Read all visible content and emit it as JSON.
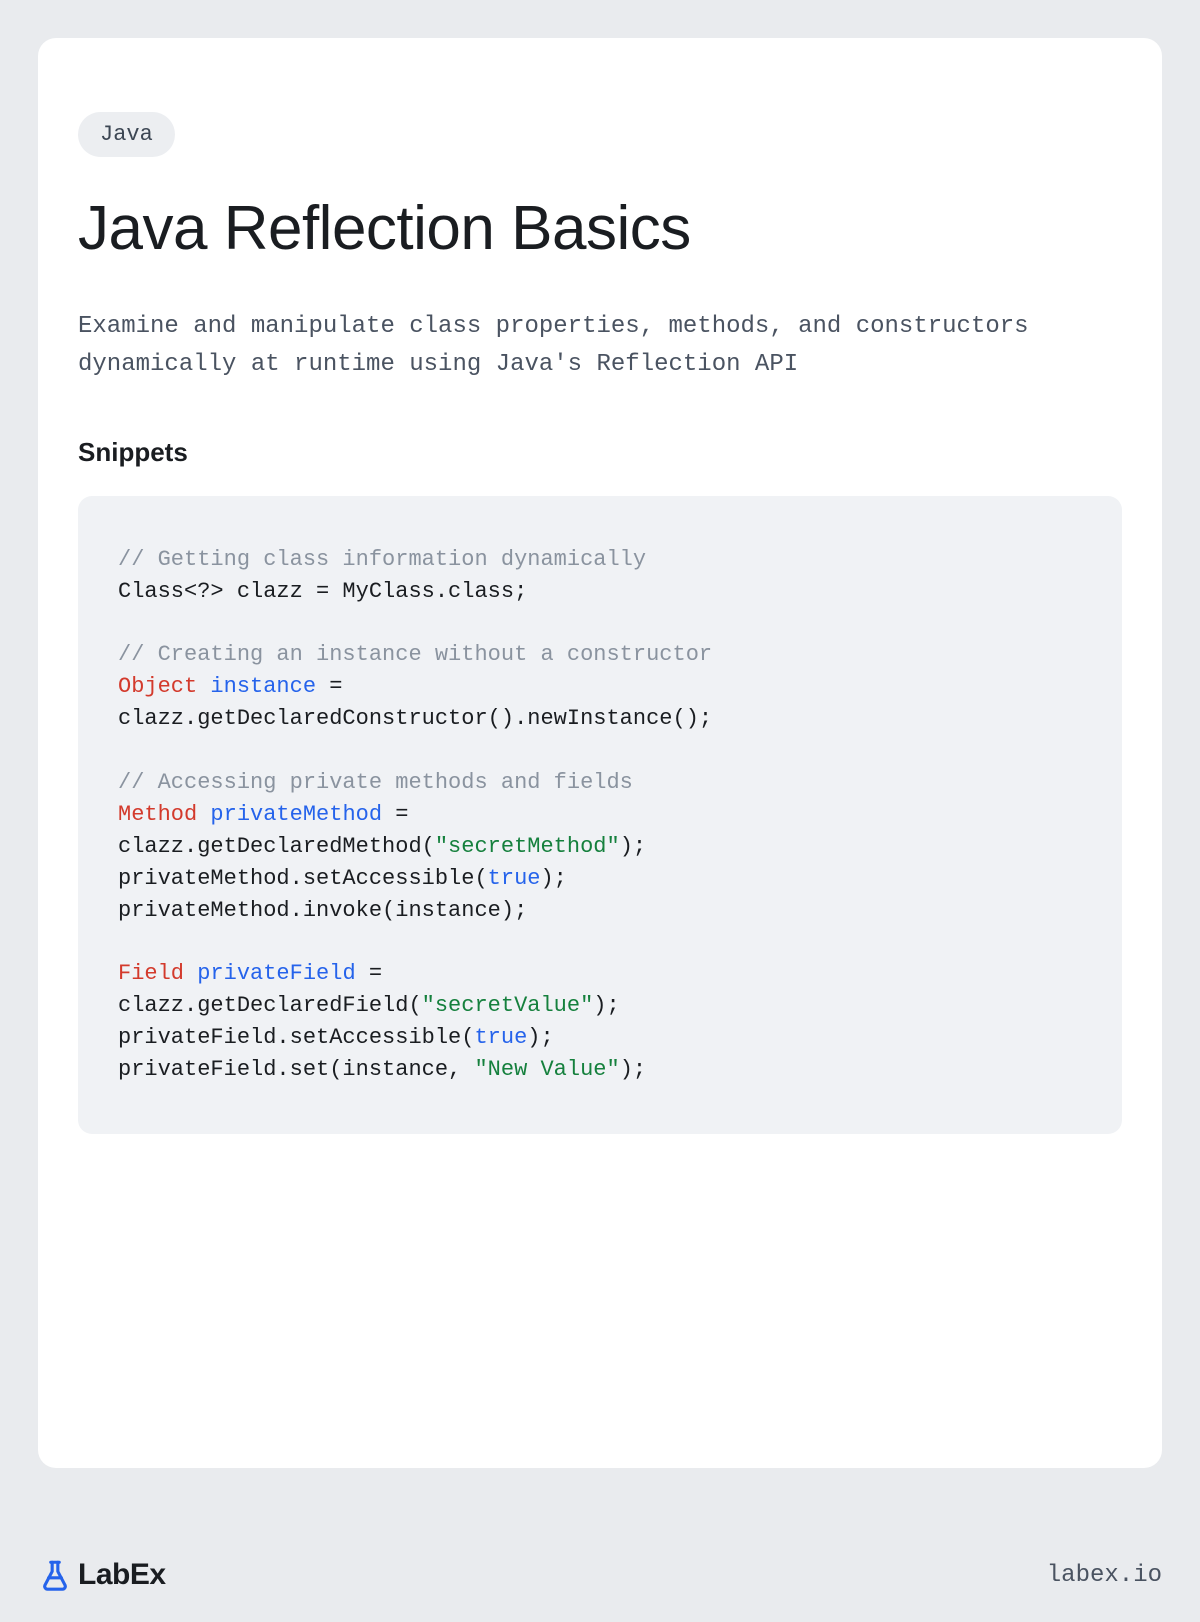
{
  "tag": "Java",
  "title": "Java Reflection Basics",
  "description": "Examine and manipulate class properties, methods, and constructors dynamically at runtime using Java's Reflection API",
  "section_heading": "Snippets",
  "code": {
    "c1": "// Getting class information dynamically",
    "l1": "Class<?> clazz = MyClass.class;",
    "c2": "// Creating an instance without a constructor",
    "t1": "Object",
    "v1": "instance",
    "eq": " =",
    "l2": "clazz.getDeclaredConstructor().newInstance();",
    "c3": "// Accessing private methods and fields",
    "t2": "Method",
    "v2": "privateMethod",
    "l3a": "clazz.getDeclaredMethod(",
    "s1": "\"secretMethod\"",
    "l3b": ");",
    "l4a": "privateMethod.setAccessible(",
    "b1": "true",
    "l4b": ");",
    "l5": "privateMethod.invoke(instance);",
    "t3": "Field",
    "v3": "privateField",
    "l6a": "clazz.getDeclaredField(",
    "s2": "\"secretValue\"",
    "l6b": ");",
    "l7a": "privateField.setAccessible(",
    "b2": "true",
    "l7b": ");",
    "l8a": "privateField.set(instance, ",
    "s3": "\"New Value\"",
    "l8b": ");"
  },
  "footer": {
    "logo_text": "LabEx",
    "url": "labex.io"
  }
}
